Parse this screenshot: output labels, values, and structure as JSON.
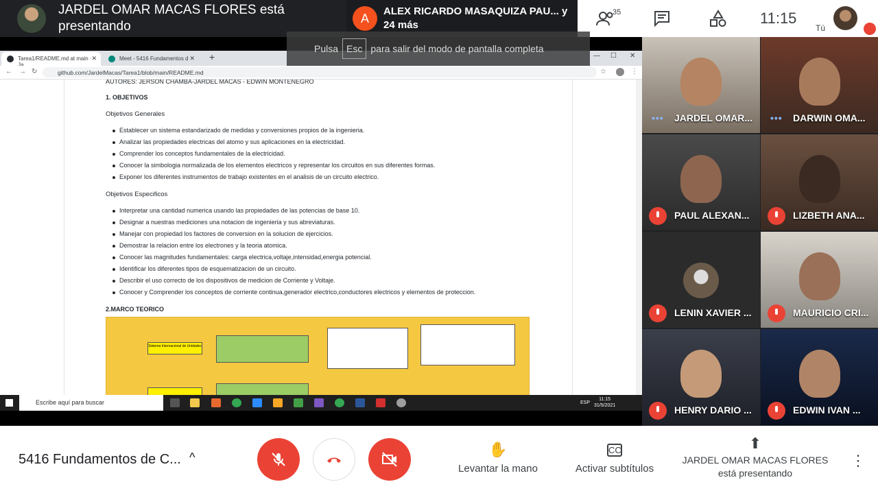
{
  "topbar": {
    "presenter_text": "JARDEL OMAR MACAS FLORES está presentando",
    "others_initial": "A",
    "others_text": "ALEX RICARDO MASAQUIZA PAU... y 24 más",
    "participants_count": "35",
    "time": "11:15",
    "you_label": "Tú"
  },
  "browser": {
    "tabs": [
      {
        "label": "Tarea1/README.md at main · Ja"
      },
      {
        "label": "Meet - 5416 Fundamentos d"
      }
    ],
    "url": "github.com/JardelMacas/Tarea1/blob/main/README.md",
    "esc_hint_before": "Pulsa",
    "esc_key": "Esc",
    "esc_hint_after": "para salir del modo de pantalla completa"
  },
  "readme": {
    "authors": "AUTORES: JERSON CHAMBA-JARDEL MACAS - EDWIN MONTENEGRO",
    "section1": "1. OBJETIVOS",
    "general_title": "Objetivos Generales",
    "general": [
      "Establecer un sistema estandarizado de medidas y conversiones propios de la ingenieria.",
      "Analizar las propiedades electricas del atomo y sus aplicaciones en la electricidad.",
      "Comprender los conceptos fundamentales de la electricidad.",
      "Conocer la simbologia normalizada de los elementos electricos y representar los circuitos en sus diferentes formas.",
      "Exponer los diferentes instrumentos de trabajo existentes en el analisis de un circuito electrico."
    ],
    "specific_title": "Objetivos Especificos",
    "specific": [
      "Interpretar una cantidad numerica usando las propiedades de las potencias de base 10.",
      "Designar a nuestras mediciones una notacion de ingenieria y sus abreviaturas.",
      "Manejar con propiedad los factores de conversion en la solucion de ejercicios.",
      "Demostrar la relacion entre los electrones y la teoria atomica.",
      "Conocer las magnitudes fundamentales: carga electrica,voltaje,intensidad,energia potencial.",
      "Identificar los diferentes tipos de esquematizacion de un circuito.",
      "Describir el uso correcto de los dispositivos de medicion de Corriente y Voltaje.",
      "Conocer y Comprender los conceptos de corriente continua,generador electrico,conductores electricos y elementos de proteccion."
    ],
    "section2": "2.MARCO TEORICO",
    "diagram_box": "Sistema Internacional de Unidades"
  },
  "taskbar": {
    "search_placeholder": "Escribe aquí para buscar",
    "lang": "ESP",
    "time": "11:15",
    "date": "31/5/2021"
  },
  "participants": [
    {
      "name": "JARDEL OMAR...",
      "muted": false
    },
    {
      "name": "DARWIN OMA...",
      "muted": false
    },
    {
      "name": "PAUL ALEXAN...",
      "muted": true
    },
    {
      "name": "LIZBETH ANA...",
      "muted": true
    },
    {
      "name": "LENIN XAVIER ...",
      "muted": true
    },
    {
      "name": "MAURICIO CRI...",
      "muted": true
    },
    {
      "name": "HENRY DARIO ...",
      "muted": true
    },
    {
      "name": "EDWIN IVAN ...",
      "muted": true
    }
  ],
  "bottombar": {
    "meeting_title": "5416 Fundamentos de C...",
    "raise_hand": "Levantar la mano",
    "captions": "Activar subtítulos",
    "presenting": "JARDEL OMAR MACAS FLORES está presentando"
  },
  "colors": {
    "red": "#ea4335",
    "dark": "#202124",
    "accent_blue": "#8ab4f8"
  }
}
